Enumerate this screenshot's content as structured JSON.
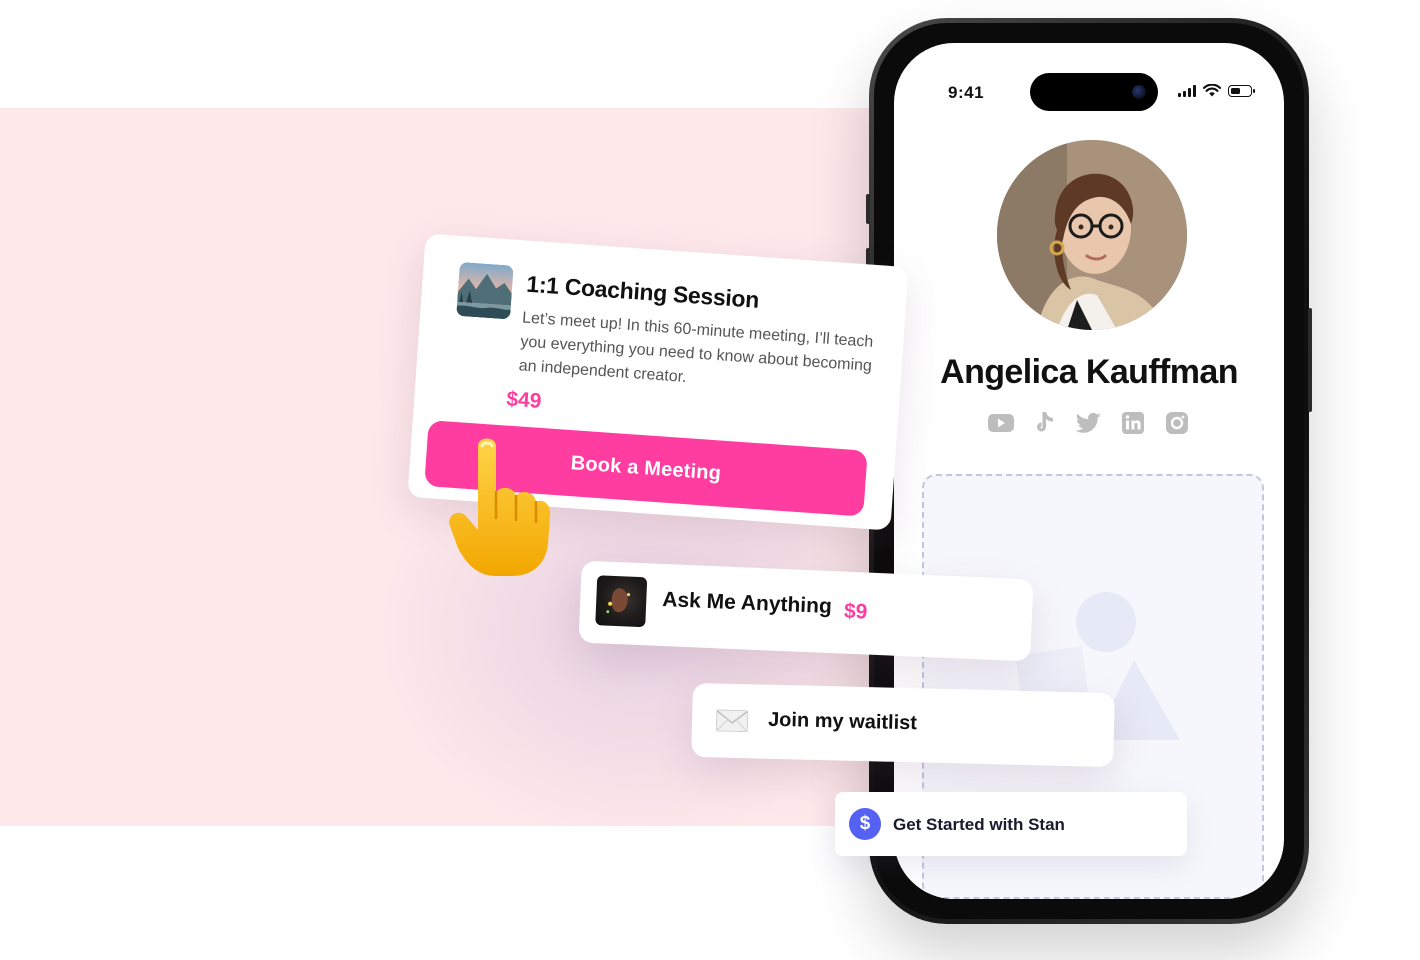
{
  "phone": {
    "status_time": "9:41",
    "profile": {
      "name": "Angelica Kauffman",
      "socials": [
        {
          "name": "youtube-icon"
        },
        {
          "name": "tiktok-icon"
        },
        {
          "name": "twitter-icon"
        },
        {
          "name": "linkedin-icon"
        },
        {
          "name": "instagram-icon"
        }
      ]
    }
  },
  "coaching": {
    "title": "1:1 Coaching Session",
    "description": "Let’s meet up! In this 60-minute meeting, I’ll teach you everything you need to know about becoming an independent creator.",
    "price": "$49",
    "button_label": "Book a Meeting"
  },
  "ama": {
    "label": "Ask Me Anything",
    "price": "$9"
  },
  "waitlist": {
    "label": "Join my waitlist"
  },
  "stan": {
    "label": "Get Started with Stan",
    "icon_glyph": "$"
  },
  "colors": {
    "accent_pink": "#ff3ca0",
    "background_pink": "#fde8ea",
    "stan_purple": "#5461f2"
  }
}
